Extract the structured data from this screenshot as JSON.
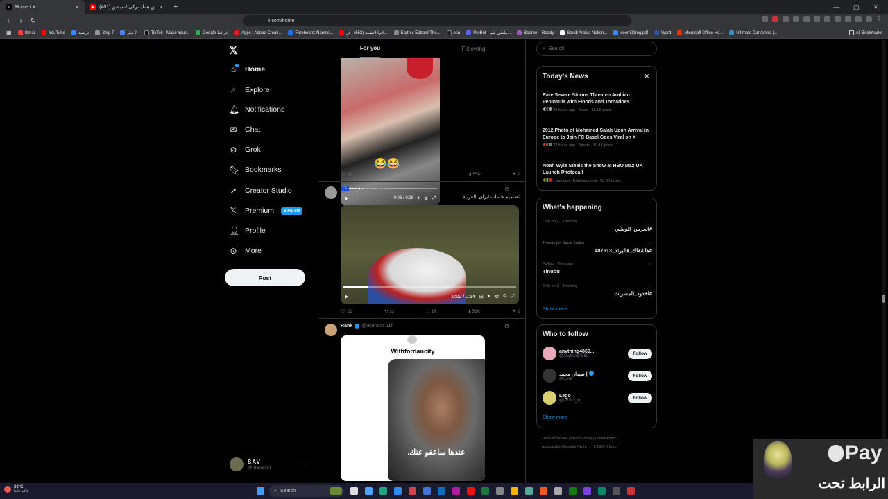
{
  "browser": {
    "tabs": [
      {
        "title": "Home / X",
        "active": true
      },
      {
        "title": "(401) بورك من هاتك تركي انميشن",
        "active": false
      }
    ],
    "url": "x.com/home",
    "bookmarks": [
      "Gmail",
      "YouTube",
      "ترجمة",
      "Ship 7",
      "الأخبار",
      "TikTok - Make Your...",
      "Google خرائط",
      "Apps | Adobe Creati...",
      "Forebears: Names...",
      "اقرا اخشت (652) | قر...",
      "Earth x Eobard The...",
      "osn",
      "ProBot - ملتقى شيا...",
      "Scener – Ready",
      "Saudi Arabia Nation...",
      "ceem22mq.pdf",
      "Word",
      "Microsoft Office Ho...",
      "Ultimate Car Arena |..."
    ],
    "all_bookmarks": "All Bookmarks"
  },
  "nav": {
    "items": [
      {
        "label": "Home",
        "icon": "home-icon"
      },
      {
        "label": "Explore",
        "icon": "search-icon"
      },
      {
        "label": "Notifications",
        "icon": "bell-icon"
      },
      {
        "label": "Chat",
        "icon": "mail-icon"
      },
      {
        "label": "Grok",
        "icon": "grok-icon"
      },
      {
        "label": "Bookmarks",
        "icon": "bookmark-icon"
      },
      {
        "label": "Creator Studio",
        "icon": "rocket-icon"
      },
      {
        "label": "Premium",
        "icon": "x-icon"
      },
      {
        "label": "Profile",
        "icon": "person-icon"
      },
      {
        "label": "More",
        "icon": "more-circle-icon"
      }
    ],
    "premium_badge": "50% off",
    "post": "Post",
    "account": {
      "name": "SAV",
      "handle": "@realsavv1"
    }
  },
  "timeline": {
    "tabs": [
      "For you",
      "Following"
    ],
    "post1": {
      "video_time": "0:06 / 0:28",
      "replies": "13",
      "reposts": "13",
      "likes": "261",
      "views": "55K"
    },
    "post2": {
      "handle": "@an43327",
      "date": "Mar 24",
      "text": "تصاميم حساب ايران بالعربية",
      "video_time": "0:02 / 0:14",
      "replies": "22",
      "reposts": "32",
      "likes": "1K",
      "views": "59K"
    },
    "post3": {
      "name": "Rank",
      "handle": "@userank",
      "date": "11h",
      "card_title": "Withfordancity",
      "caption": "عندها ساعفو عنك."
    }
  },
  "right": {
    "search_placeholder": "Search",
    "news_title": "Today's News",
    "news": [
      {
        "headline": "Rare Severe Storms Threaten Arabian Peninsula with Floods and Tornadoes",
        "meta": "23 hours ago · News · 15.1K posts"
      },
      {
        "headline": "2012 Photo of Mohamed Salah Upon Arrival in Europe to Join FC Basel Goes Viral on X",
        "meta": "23 hours ago · Sports · 10.4K posts"
      },
      {
        "headline": "Noah Wyle Steals the Show at HBO Max UK Launch Photocall",
        "meta": "1 day ago · Entertainment · 33.8K posts"
      }
    ],
    "happening_title": "What's happening",
    "trends": [
      {
        "context": "Only on X · Trending",
        "topic": "#الحرس_الوطني"
      },
      {
        "context": "Trending in Saudi Arabia",
        "topic": "#هاشفاك_فالبرند_487613"
      },
      {
        "context": "Politics · Trending",
        "topic": "Tinubu"
      },
      {
        "context": "Only on X · Trending",
        "topic": "#اخدود_المسرات"
      }
    ],
    "show_more": "Show more",
    "wtf_title": "Who to follow",
    "follows": [
      {
        "name": "anything4860...",
        "handle": "@anything4860"
      },
      {
        "name": "ضيدان محمد |",
        "handle": "@l5lmt"
      },
      {
        "name": "Lego",
        "handle": "@LEGO_lq"
      }
    ],
    "follow_label": "Follow",
    "footer": [
      "Terms of Service",
      "Privacy Policy",
      "Cookie Policy",
      "Accessibility",
      "Ads info",
      "More ...",
      "© 2025 X Corp."
    ]
  },
  "taskbar": {
    "weather_temp": "28°C",
    "weather_text": "غائم غالباً",
    "search": "Search"
  },
  "overlay": {
    "text": "الرابط تحت",
    "pay": "Pay"
  }
}
